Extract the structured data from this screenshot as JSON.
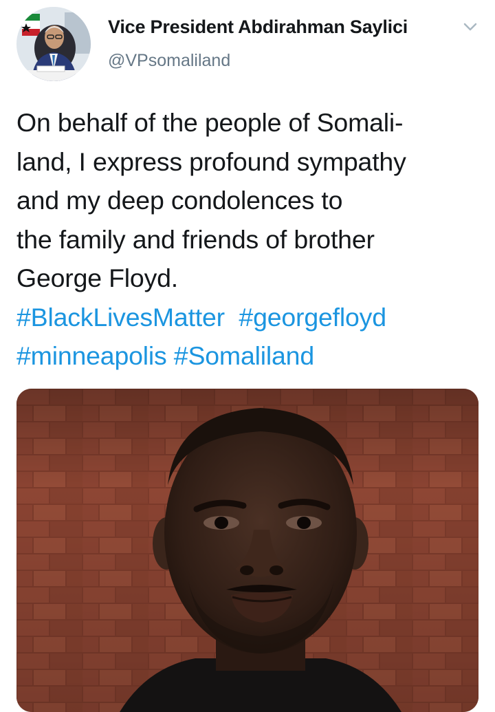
{
  "tweet": {
    "author": {
      "display_name": "Vice President Abdirahman Saylici",
      "handle": "@VPsomaliland"
    },
    "text_lines": [
      "On behalf of the people of Somali-",
      "land, I express profound sympathy",
      "and my deep condolences to",
      "the family and friends of brother",
      "George Floyd."
    ],
    "hashtags": {
      "blacklivesmatter": "#BlackLivesMatter",
      "georgefloyd": "#georgefloyd",
      "minneapolis": "#minneapolis",
      "somaliland": "#Somaliland"
    }
  },
  "icons": {
    "menu": "chevron-down-icon",
    "avatar": "avatar"
  },
  "colors": {
    "link": "#1b95e0",
    "secondary_text": "#657786",
    "primary_text": "#14171a"
  }
}
